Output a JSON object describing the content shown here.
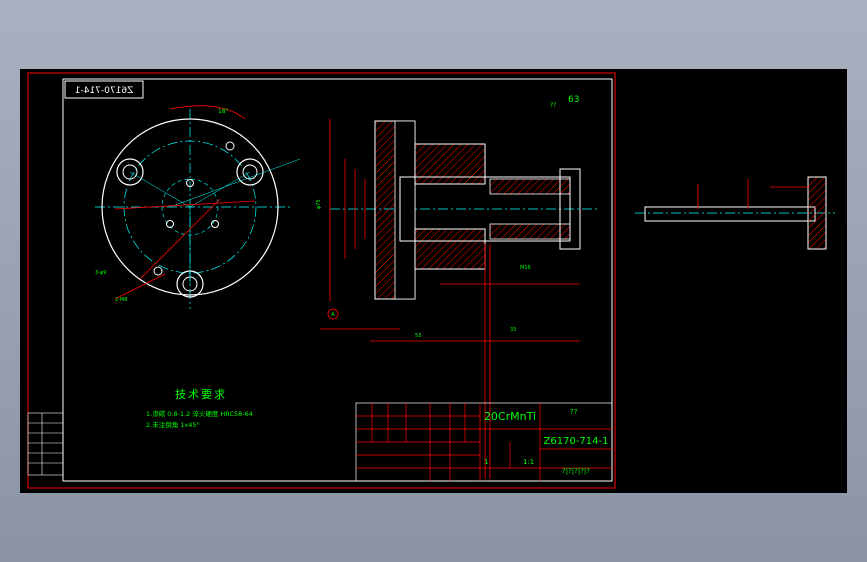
{
  "drawing": {
    "drawing_number": "Z6170-714-1",
    "mirrored_number": "Z6170-714-1",
    "material": "20CrMnTi",
    "unknown_marks": "??",
    "roughness_top": "63",
    "tech_requirements": {
      "title": "技术要求",
      "items": [
        "1.渗碳 0.8-1.2 淬火硬度 HRC58-64",
        "2.未注倒角 1x45°"
      ]
    },
    "title_block": {
      "name_cell": "??",
      "company_row": "?|?|?|?|?",
      "qty_value": "1",
      "scale_value": "1:1"
    },
    "annotations": {
      "angle_top": "18°",
      "holes_label_a": "3-φ9",
      "holes_label_b": "2-M8",
      "section_mark": "A",
      "datum_a": "A",
      "dim_len_overall": "53",
      "dim_len_tail": "33",
      "dim_thread": "M16",
      "dim_left_dia": "φ75"
    }
  },
  "colors": {
    "frame": "#ff0000",
    "text": "#00ff00",
    "outline": "#ffffff",
    "centerline": "#00ffff",
    "dimension": "#ff0000"
  }
}
